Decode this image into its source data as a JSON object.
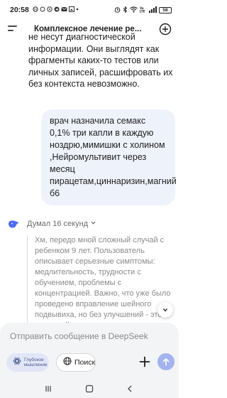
{
  "status_bar": {
    "time": "20:58",
    "battery": "58"
  },
  "header": {
    "title": "Комплексное лечение ре..."
  },
  "messages": {
    "ai_partial": "не несут диагностической информации. Они выглядят как фрагменты каких-то тестов или личных записей, расшифровать их без контекста невозможно.",
    "user": "врач назначила семакс 0,1% три капли в каждую ноздрю,мимишки с холином ,Нейромультивит через месяц пирацетам,циннаризин,магний б6",
    "thinking_label": "Думал 16 секунд",
    "thinking_text": "Хм, передо мной сложный случай с ребенком 9 лет. Пользователь описывает серьезные симптомы: медлительность, трудности с обучением, проблемы с концентрацией. Важно, что уже было проведено вправление шейного подвывиха, но без улучшений - это ключевой момент."
  },
  "composer": {
    "placeholder": "Отправить сообщение в DeepSeek",
    "deep_think_label": "Глубокое мышление",
    "search_label": "Поиск"
  },
  "colors": {
    "accent": "#4d6bfe",
    "bubble": "#eef2fb",
    "send": "#a3b3ee"
  }
}
